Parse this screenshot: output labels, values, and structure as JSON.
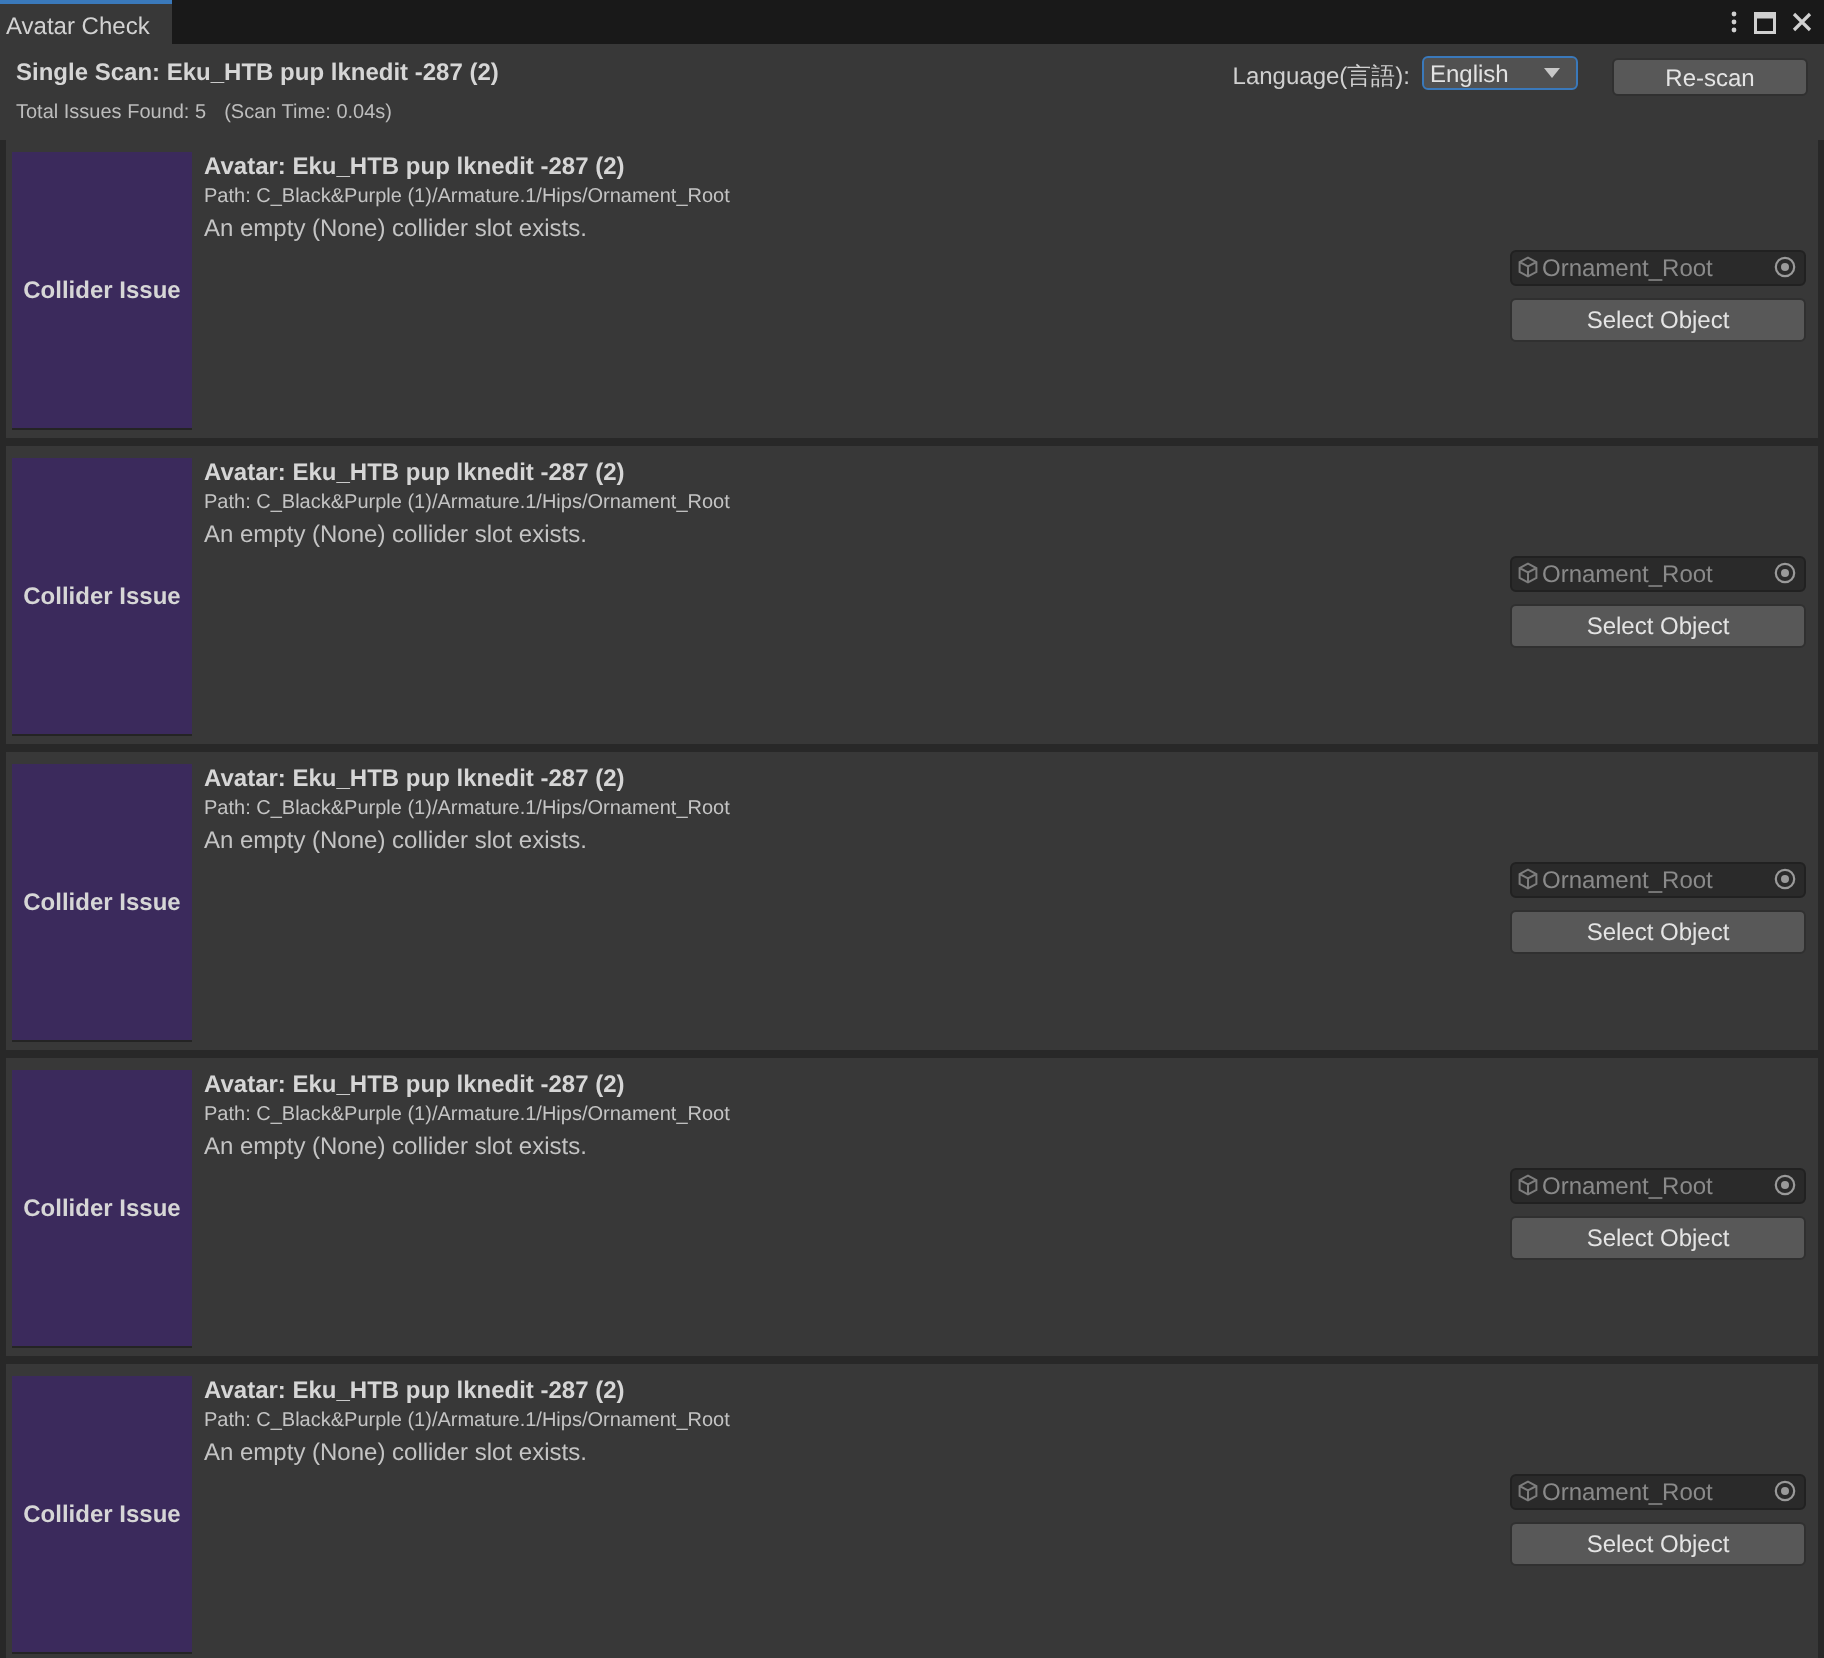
{
  "tab": {
    "label": "Avatar Check",
    "selected": true
  },
  "header": {
    "title": "Single Scan: Eku_HTB pup lknedit -287 (2)",
    "total": "Total Issues Found: 5",
    "scan_time": "(Scan Time: 0.04s)",
    "language": {
      "label": "Language(言語):",
      "value": "English",
      "focused": true
    },
    "rescan_button": "Re-scan"
  },
  "issues": [
    {
      "tag": "Collider Issue",
      "avatar": "Avatar: Eku_HTB pup lknedit -287 (2)",
      "path": "Path: C_Black&Purple (1)/Armature.1/Hips/Ornament_Root",
      "message": "An empty (None) collider slot exists.",
      "object_field": {
        "value": "Ornament_Root",
        "disabled": true
      },
      "button": "Select Object"
    },
    {
      "tag": "Collider Issue",
      "avatar": "Avatar: Eku_HTB pup lknedit -287 (2)",
      "path": "Path: C_Black&Purple (1)/Armature.1/Hips/Ornament_Root",
      "message": "An empty (None) collider slot exists.",
      "object_field": {
        "value": "Ornament_Root",
        "disabled": true
      },
      "button": "Select Object"
    },
    {
      "tag": "Collider Issue",
      "avatar": "Avatar: Eku_HTB pup lknedit -287 (2)",
      "path": "Path: C_Black&Purple (1)/Armature.1/Hips/Ornament_Root",
      "message": "An empty (None) collider slot exists.",
      "object_field": {
        "value": "Ornament_Root",
        "disabled": true
      },
      "button": "Select Object"
    },
    {
      "tag": "Collider Issue",
      "avatar": "Avatar: Eku_HTB pup lknedit -287 (2)",
      "path": "Path: C_Black&Purple (1)/Armature.1/Hips/Ornament_Root",
      "message": "An empty (None) collider slot exists.",
      "object_field": {
        "value": "Ornament_Root",
        "disabled": true
      },
      "button": "Select Object"
    },
    {
      "tag": "Collider Issue",
      "avatar": "Avatar: Eku_HTB pup lknedit -287 (2)",
      "path": "Path: C_Black&Purple (1)/Armature.1/Hips/Ornament_Root",
      "message": "An empty (None) collider slot exists.",
      "object_field": {
        "value": "Ornament_Root",
        "disabled": true
      },
      "button": "Select Object"
    }
  ]
}
